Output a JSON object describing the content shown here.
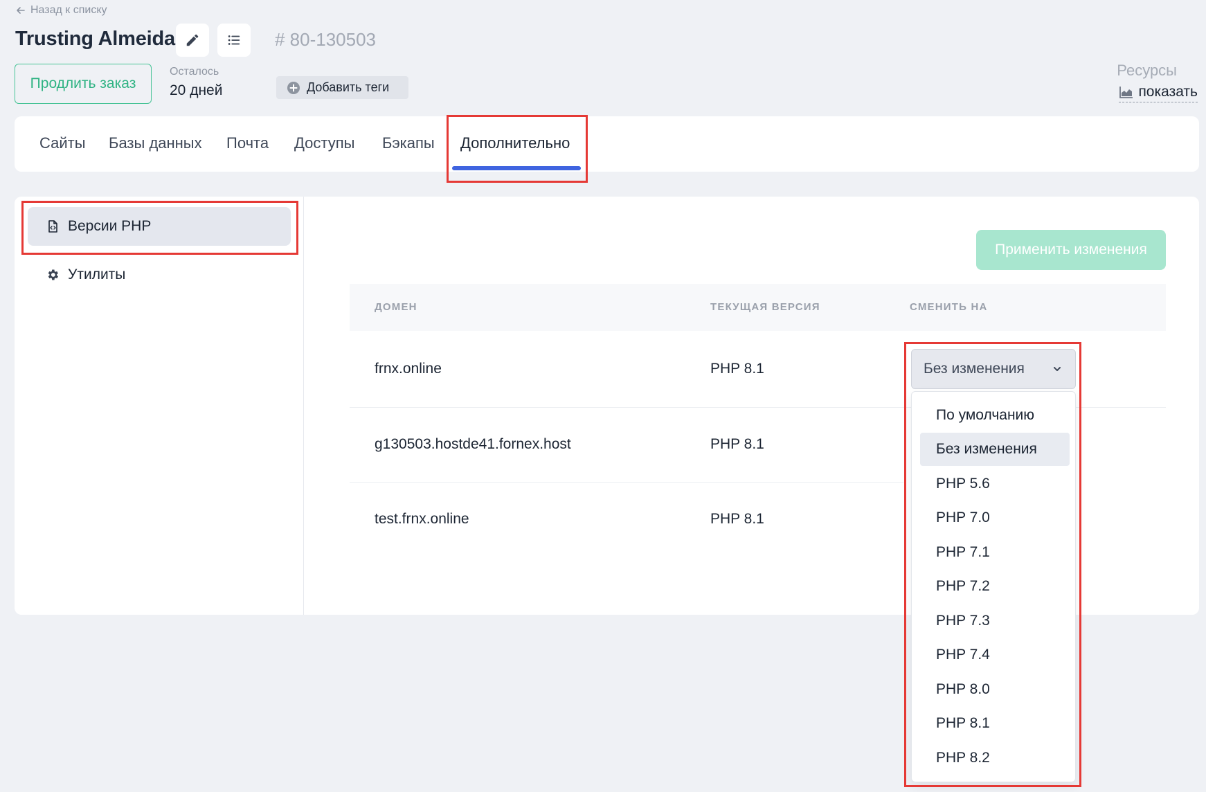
{
  "header": {
    "back_label": "Назад к списку",
    "title": "Trusting Almeida",
    "order_id": "# 80-130503",
    "renew_label": "Продлить заказ",
    "remaining_label": "Осталось",
    "remaining_value": "20 дней",
    "add_tags_label": "Добавить теги",
    "resources_label": "Ресурсы",
    "resources_show_label": "показать"
  },
  "tabs": [
    {
      "label": "Сайты"
    },
    {
      "label": "Базы данных"
    },
    {
      "label": "Почта"
    },
    {
      "label": "Доступы"
    },
    {
      "label": "Бэкапы"
    },
    {
      "label": "Дополнительно",
      "active": true
    }
  ],
  "sidebar": {
    "items": [
      {
        "label": "Версии PHP",
        "active": true
      },
      {
        "label": "Утилиты"
      }
    ]
  },
  "main": {
    "apply_label": "Применить изменения",
    "columns": [
      "ДОМЕН",
      "ТЕКУЩАЯ ВЕРСИЯ",
      "СМЕНИТЬ НА"
    ],
    "rows": [
      {
        "domain": "frnx.online",
        "current": "PHP 8.1"
      },
      {
        "domain": "g130503.hostde41.fornex.host",
        "current": "PHP 8.1"
      },
      {
        "domain": "test.frnx.online",
        "current": "PHP 8.1"
      }
    ],
    "select_value": "Без изменения",
    "options": [
      "По умолчанию",
      "Без изменения",
      "PHP 5.6",
      "PHP 7.0",
      "PHP 7.1",
      "PHP 7.2",
      "PHP 7.3",
      "PHP 7.4",
      "PHP 8.0",
      "PHP 8.1",
      "PHP 8.2"
    ]
  },
  "colors": {
    "accent_blue": "#3f64e0",
    "brand_green": "#2fb383",
    "apply_disabled_green": "#a8e6cf",
    "highlight_red": "#e53935",
    "background": "#eff1f5"
  }
}
